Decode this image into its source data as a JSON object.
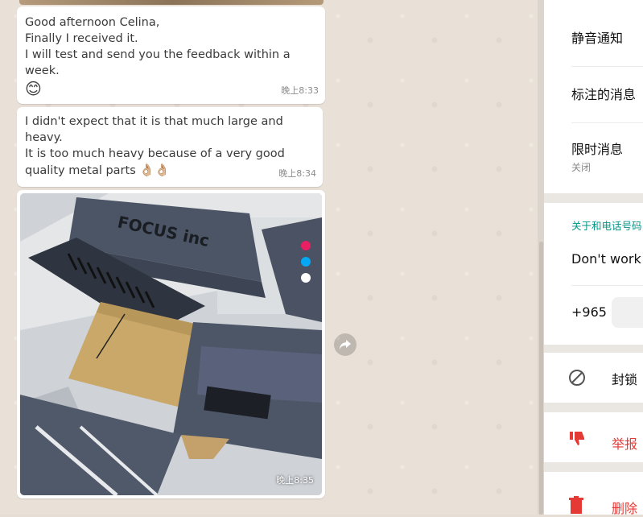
{
  "chat": {
    "messages": [
      {
        "lines": "Good afternoon Celina,\nFinally I received it.\nI will test and send you the feedback within a week.",
        "emoji": "😊",
        "time": "晚上8:33"
      },
      {
        "lines": "I didn't expect that it is that much large and heavy.\nIt is too much heavy because of a very good quality metal parts",
        "emoji": "👌🏼👌🏼",
        "time": "晚上8:34"
      },
      {
        "image_alt": "Photo of a FOCUS inc printer",
        "brand_text": "FOCUS inc",
        "time": "晚上8:35"
      }
    ],
    "forward_icon": "forward-arrow-icon"
  },
  "info_panel": {
    "mute": "静音通知",
    "starred": "标注的消息",
    "disappearing": {
      "label": "限时消息",
      "value": "关闭"
    },
    "about_header": "关于和电话号码",
    "about_text": "Don't work",
    "phone": "+965",
    "block": "封锁",
    "report": "举报",
    "delete": "删除"
  },
  "colors": {
    "teal": "#009688",
    "danger": "#e53935"
  }
}
